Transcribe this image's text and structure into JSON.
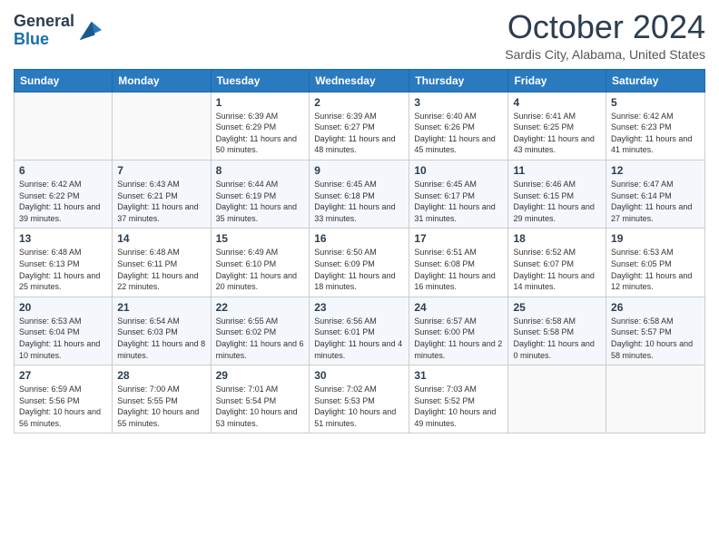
{
  "logo": {
    "line1": "General",
    "line2": "Blue"
  },
  "title": "October 2024",
  "location": "Sardis City, Alabama, United States",
  "days_of_week": [
    "Sunday",
    "Monday",
    "Tuesday",
    "Wednesday",
    "Thursday",
    "Friday",
    "Saturday"
  ],
  "weeks": [
    [
      {
        "day": "",
        "info": ""
      },
      {
        "day": "",
        "info": ""
      },
      {
        "day": "1",
        "info": "Sunrise: 6:39 AM\nSunset: 6:29 PM\nDaylight: 11 hours and 50 minutes."
      },
      {
        "day": "2",
        "info": "Sunrise: 6:39 AM\nSunset: 6:27 PM\nDaylight: 11 hours and 48 minutes."
      },
      {
        "day": "3",
        "info": "Sunrise: 6:40 AM\nSunset: 6:26 PM\nDaylight: 11 hours and 45 minutes."
      },
      {
        "day": "4",
        "info": "Sunrise: 6:41 AM\nSunset: 6:25 PM\nDaylight: 11 hours and 43 minutes."
      },
      {
        "day": "5",
        "info": "Sunrise: 6:42 AM\nSunset: 6:23 PM\nDaylight: 11 hours and 41 minutes."
      }
    ],
    [
      {
        "day": "6",
        "info": "Sunrise: 6:42 AM\nSunset: 6:22 PM\nDaylight: 11 hours and 39 minutes."
      },
      {
        "day": "7",
        "info": "Sunrise: 6:43 AM\nSunset: 6:21 PM\nDaylight: 11 hours and 37 minutes."
      },
      {
        "day": "8",
        "info": "Sunrise: 6:44 AM\nSunset: 6:19 PM\nDaylight: 11 hours and 35 minutes."
      },
      {
        "day": "9",
        "info": "Sunrise: 6:45 AM\nSunset: 6:18 PM\nDaylight: 11 hours and 33 minutes."
      },
      {
        "day": "10",
        "info": "Sunrise: 6:45 AM\nSunset: 6:17 PM\nDaylight: 11 hours and 31 minutes."
      },
      {
        "day": "11",
        "info": "Sunrise: 6:46 AM\nSunset: 6:15 PM\nDaylight: 11 hours and 29 minutes."
      },
      {
        "day": "12",
        "info": "Sunrise: 6:47 AM\nSunset: 6:14 PM\nDaylight: 11 hours and 27 minutes."
      }
    ],
    [
      {
        "day": "13",
        "info": "Sunrise: 6:48 AM\nSunset: 6:13 PM\nDaylight: 11 hours and 25 minutes."
      },
      {
        "day": "14",
        "info": "Sunrise: 6:48 AM\nSunset: 6:11 PM\nDaylight: 11 hours and 22 minutes."
      },
      {
        "day": "15",
        "info": "Sunrise: 6:49 AM\nSunset: 6:10 PM\nDaylight: 11 hours and 20 minutes."
      },
      {
        "day": "16",
        "info": "Sunrise: 6:50 AM\nSunset: 6:09 PM\nDaylight: 11 hours and 18 minutes."
      },
      {
        "day": "17",
        "info": "Sunrise: 6:51 AM\nSunset: 6:08 PM\nDaylight: 11 hours and 16 minutes."
      },
      {
        "day": "18",
        "info": "Sunrise: 6:52 AM\nSunset: 6:07 PM\nDaylight: 11 hours and 14 minutes."
      },
      {
        "day": "19",
        "info": "Sunrise: 6:53 AM\nSunset: 6:05 PM\nDaylight: 11 hours and 12 minutes."
      }
    ],
    [
      {
        "day": "20",
        "info": "Sunrise: 6:53 AM\nSunset: 6:04 PM\nDaylight: 11 hours and 10 minutes."
      },
      {
        "day": "21",
        "info": "Sunrise: 6:54 AM\nSunset: 6:03 PM\nDaylight: 11 hours and 8 minutes."
      },
      {
        "day": "22",
        "info": "Sunrise: 6:55 AM\nSunset: 6:02 PM\nDaylight: 11 hours and 6 minutes."
      },
      {
        "day": "23",
        "info": "Sunrise: 6:56 AM\nSunset: 6:01 PM\nDaylight: 11 hours and 4 minutes."
      },
      {
        "day": "24",
        "info": "Sunrise: 6:57 AM\nSunset: 6:00 PM\nDaylight: 11 hours and 2 minutes."
      },
      {
        "day": "25",
        "info": "Sunrise: 6:58 AM\nSunset: 5:58 PM\nDaylight: 11 hours and 0 minutes."
      },
      {
        "day": "26",
        "info": "Sunrise: 6:58 AM\nSunset: 5:57 PM\nDaylight: 10 hours and 58 minutes."
      }
    ],
    [
      {
        "day": "27",
        "info": "Sunrise: 6:59 AM\nSunset: 5:56 PM\nDaylight: 10 hours and 56 minutes."
      },
      {
        "day": "28",
        "info": "Sunrise: 7:00 AM\nSunset: 5:55 PM\nDaylight: 10 hours and 55 minutes."
      },
      {
        "day": "29",
        "info": "Sunrise: 7:01 AM\nSunset: 5:54 PM\nDaylight: 10 hours and 53 minutes."
      },
      {
        "day": "30",
        "info": "Sunrise: 7:02 AM\nSunset: 5:53 PM\nDaylight: 10 hours and 51 minutes."
      },
      {
        "day": "31",
        "info": "Sunrise: 7:03 AM\nSunset: 5:52 PM\nDaylight: 10 hours and 49 minutes."
      },
      {
        "day": "",
        "info": ""
      },
      {
        "day": "",
        "info": ""
      }
    ]
  ]
}
